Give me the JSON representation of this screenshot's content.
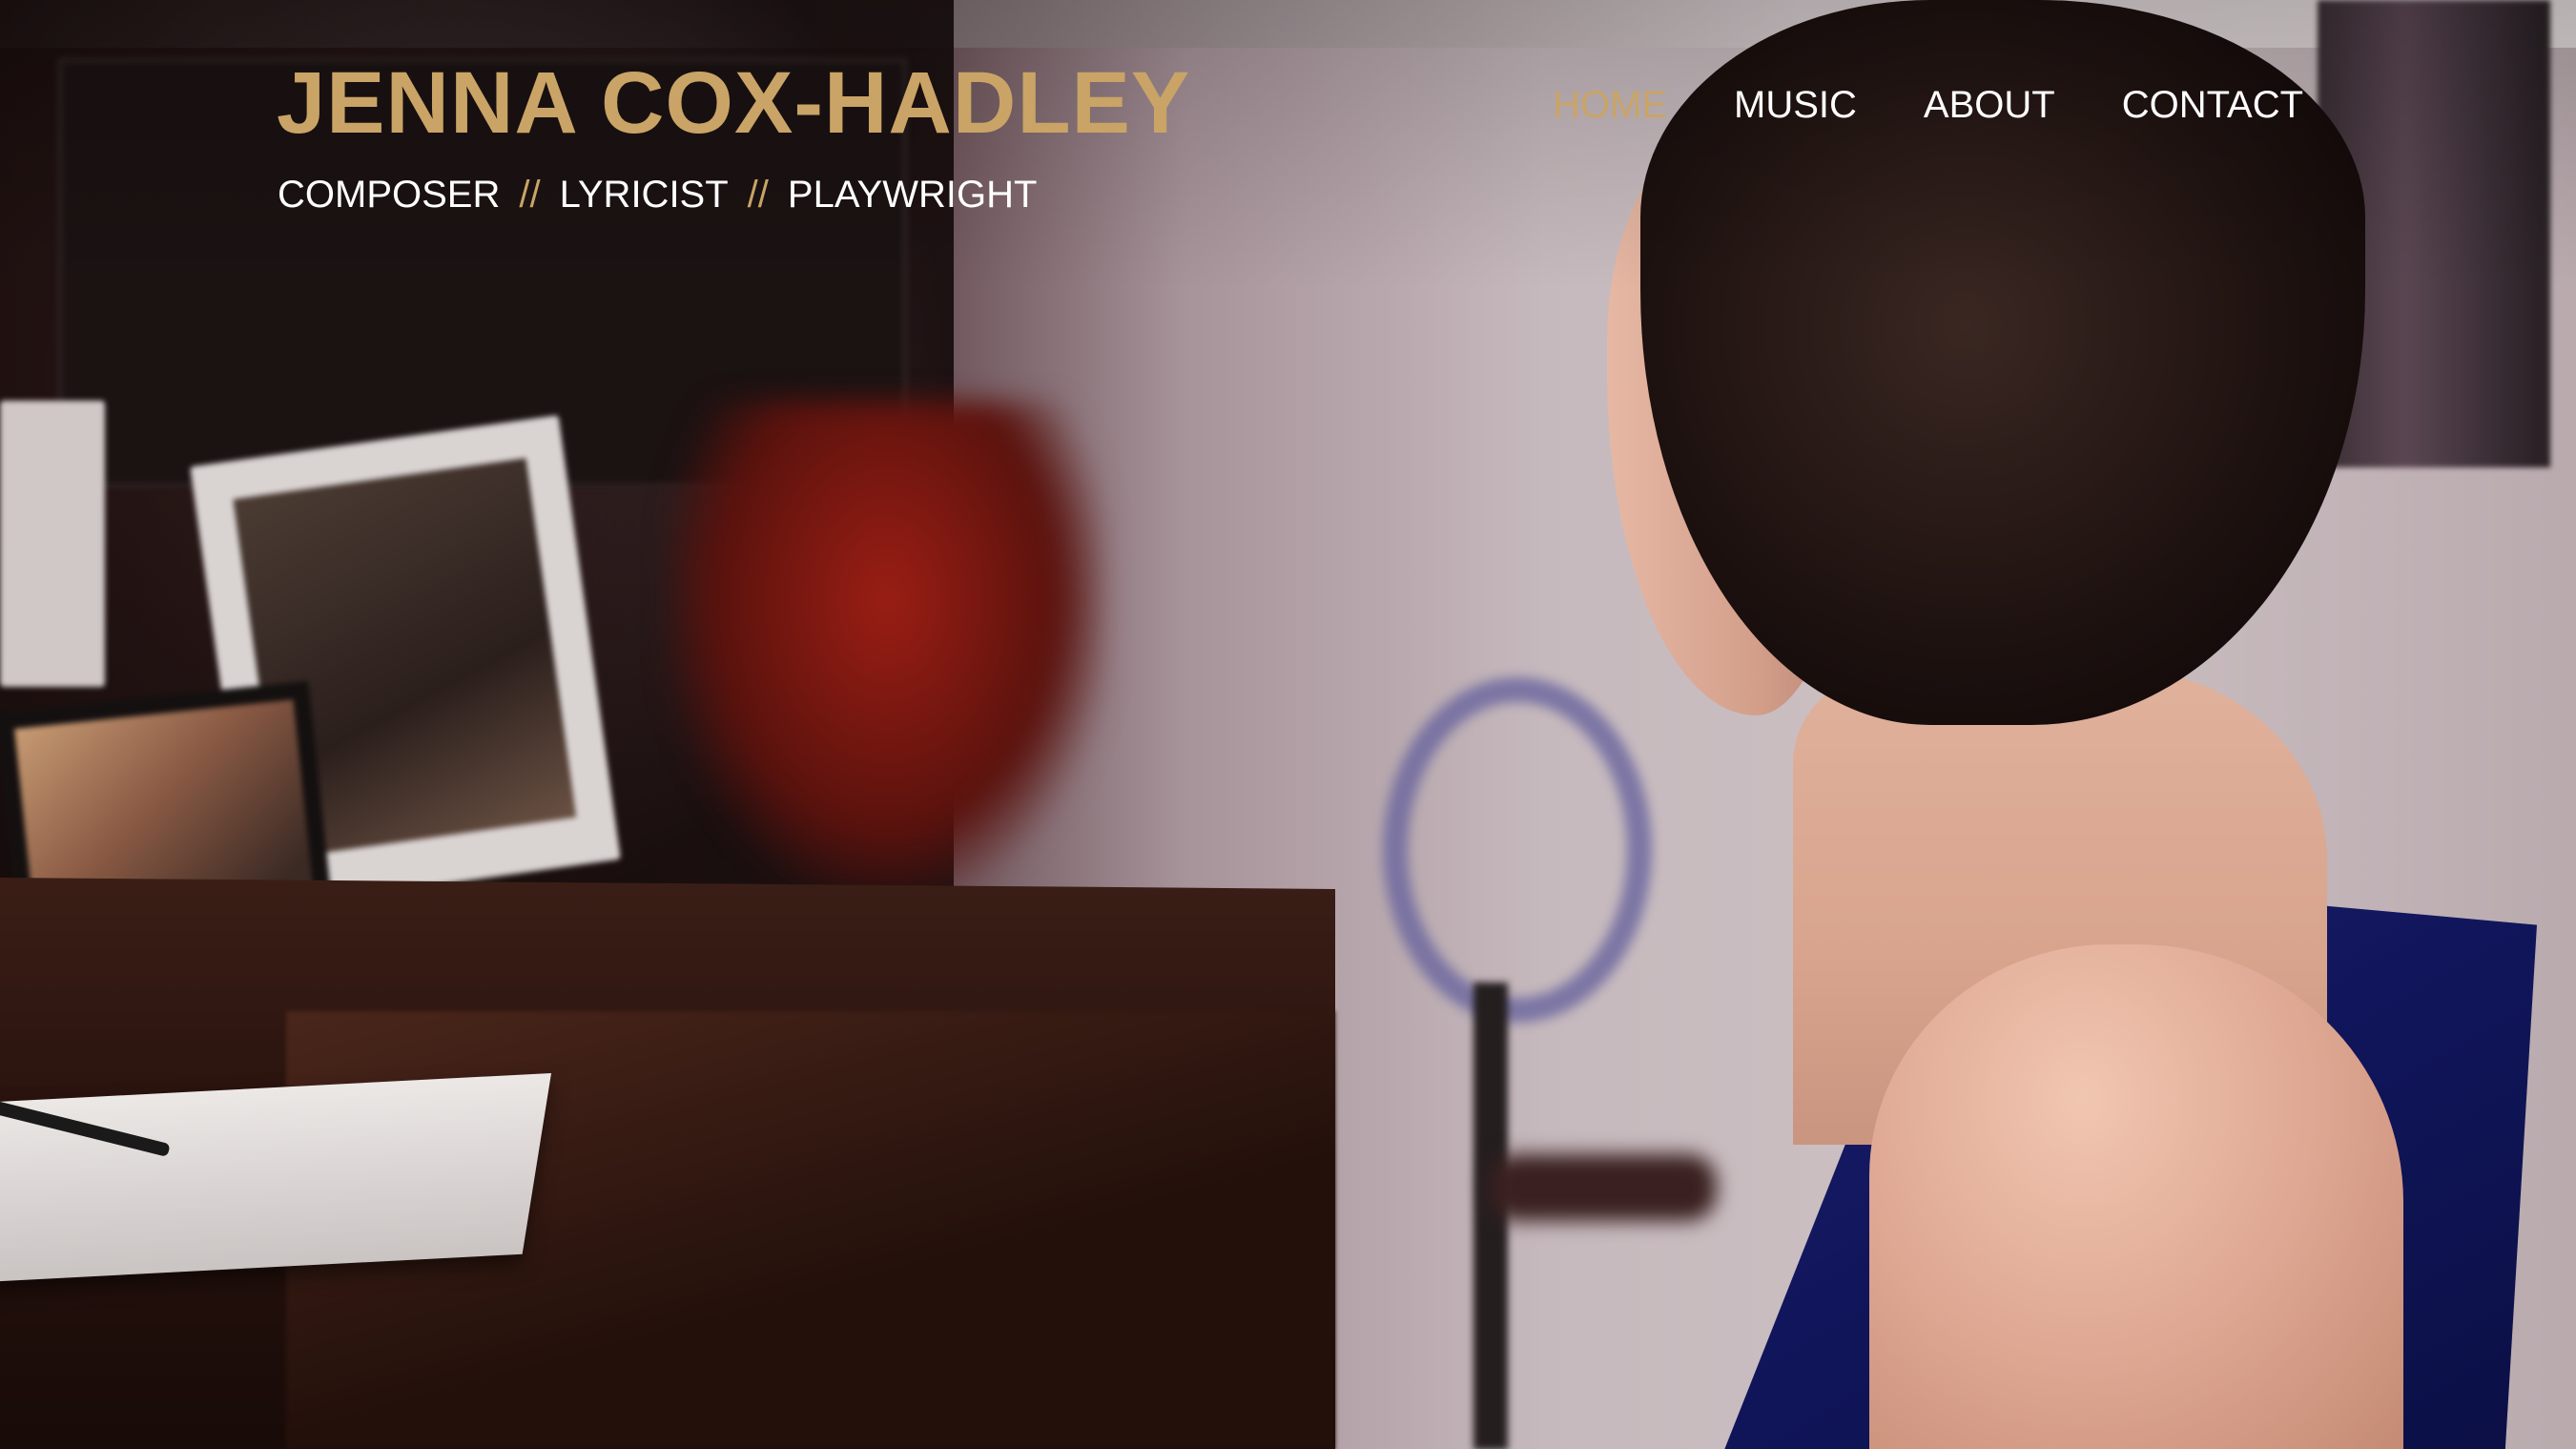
{
  "site": {
    "title": "JENNA COX-HADLEY",
    "tagline": {
      "roles": [
        "COMPOSER",
        "LYRICIST",
        "PLAYWRIGHT"
      ],
      "separator": "//"
    }
  },
  "nav": {
    "items": [
      {
        "label": "HOME",
        "active": true
      },
      {
        "label": "MUSIC",
        "active": false
      },
      {
        "label": "ABOUT",
        "active": false
      },
      {
        "label": "CONTACT",
        "active": false
      }
    ]
  },
  "colors": {
    "accent_gold": "#c9a466",
    "nav_text": "#ffffff"
  }
}
